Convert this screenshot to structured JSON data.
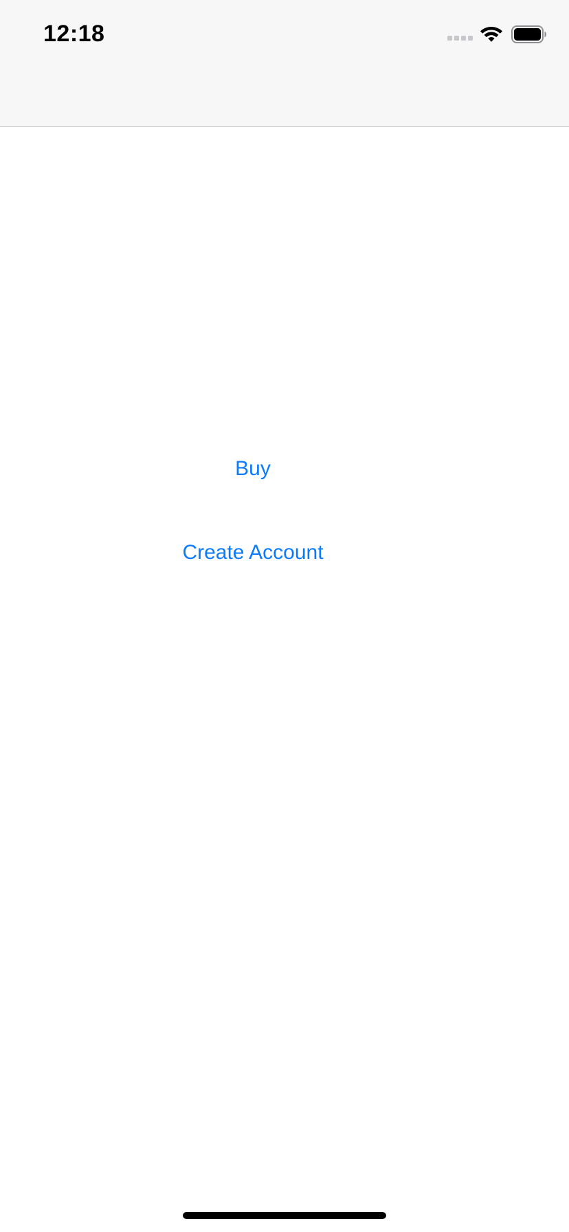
{
  "status_bar": {
    "time": "12:18",
    "icons": [
      "cellular-signal-icon",
      "wifi-icon",
      "battery-icon"
    ]
  },
  "main": {
    "buy_label": "Buy",
    "create_account_label": "Create Account"
  },
  "colors": {
    "accent": "#0a7aff",
    "nav_background": "#f7f7f7",
    "separator": "#b2b2b2",
    "signal_inactive": "#c7c7cc"
  }
}
